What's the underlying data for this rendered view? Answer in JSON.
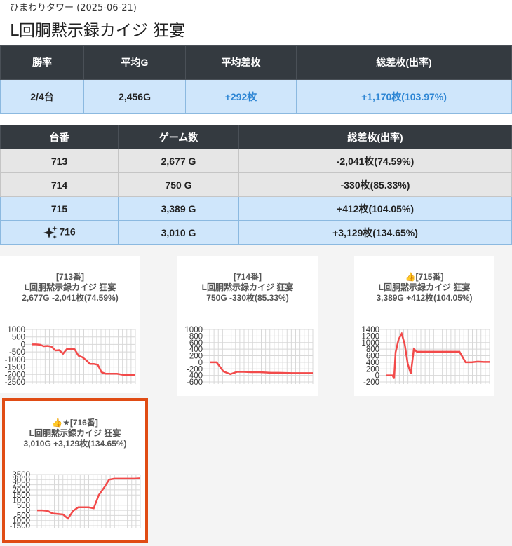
{
  "header": {
    "subtitle": "ひまわりタワー (2025-06-21)",
    "title": "L回胴黙示録カイジ 狂宴"
  },
  "summary": {
    "headers": [
      "勝率",
      "平均G",
      "平均差枚",
      "総差枚(出率)"
    ],
    "values": [
      "2/4台",
      "2,456G",
      "+292枚",
      "+1,170枚(103.97%)"
    ]
  },
  "machines": {
    "headers": [
      "台番",
      "ゲーム数",
      "総差枚(出率)"
    ],
    "rows": [
      {
        "number": "713",
        "games": "2,677 G",
        "total": "-2,041枚(74.59%)",
        "style": "gray"
      },
      {
        "number": "714",
        "games": "750 G",
        "total": "-330枚(85.33%)",
        "style": "gray"
      },
      {
        "number": "715",
        "games": "3,389 G",
        "total": "+412枚(104.05%)",
        "style": "blue"
      },
      {
        "number": "716",
        "games": "3,010 G",
        "total": "+3,129枚(134.65%)",
        "style": "blue",
        "icon": "sparkle-icon"
      }
    ]
  },
  "cards": [
    {
      "line1": "[713番]",
      "line2": "L回胴黙示録カイジ 狂宴",
      "line3": "2,677G -2,041枚(74.59%)",
      "highlighted": false
    },
    {
      "line1": "[714番]",
      "line2": "L回胴黙示録カイジ 狂宴",
      "line3": "750G -330枚(85.33%)",
      "highlighted": false
    },
    {
      "line1": "👍[715番]",
      "line2": "L回胴黙示録カイジ 狂宴",
      "line3": "3,389G +412枚(104.05%)",
      "highlighted": false
    },
    {
      "line1": "👍★[716番]",
      "line2": "L回胴黙示録カイジ 狂宴",
      "line3": "3,010G +3,129枚(134.65%)",
      "highlighted": true
    }
  ],
  "chart_data": [
    {
      "type": "line",
      "title": "[713番]",
      "yticks": [
        1000,
        500,
        0,
        -500,
        -1000,
        -1500,
        -2000,
        -2500
      ],
      "ylim": [
        -2500,
        1000
      ],
      "x": [
        0,
        100,
        200,
        300,
        400,
        500,
        600,
        700,
        800,
        900,
        1000,
        1100,
        1200,
        1300,
        1400,
        1500,
        1600,
        1700,
        1800,
        1900,
        2000,
        2100,
        2200,
        2300,
        2400,
        2500,
        2677
      ],
      "values": [
        0,
        0,
        -20,
        -120,
        -100,
        -150,
        -400,
        -380,
        -620,
        -300,
        -300,
        -320,
        -750,
        -850,
        -1050,
        -1300,
        -1300,
        -1350,
        -1850,
        -1950,
        -1950,
        -1950,
        -1950,
        -2000,
        -2041,
        -2041,
        -2041
      ],
      "color": "#f24a4a"
    },
    {
      "type": "line",
      "title": "[714番]",
      "yticks": [
        1000,
        800,
        600,
        400,
        200,
        0,
        -200,
        -400,
        -600
      ],
      "ylim": [
        -600,
        1000
      ],
      "x": [
        0,
        50,
        100,
        150,
        200,
        250,
        300,
        350,
        400,
        450,
        500,
        550,
        600,
        650,
        700,
        750
      ],
      "values": [
        0,
        0,
        -280,
        -360,
        -290,
        -290,
        -300,
        -300,
        -310,
        -320,
        -320,
        -325,
        -330,
        -330,
        -330,
        -330
      ],
      "color": "#f24a4a"
    },
    {
      "type": "line",
      "title": "[715番]",
      "yticks": [
        1400,
        1200,
        1000,
        800,
        600,
        400,
        200,
        0,
        -200
      ],
      "ylim": [
        -200,
        1400
      ],
      "x": [
        0,
        100,
        200,
        250,
        300,
        400,
        500,
        600,
        700,
        800,
        900,
        1000,
        1100,
        1200,
        1400,
        1600,
        1800,
        2000,
        2200,
        2400,
        2600,
        2800,
        3000,
        3200,
        3389
      ],
      "values": [
        0,
        0,
        0,
        -100,
        700,
        1100,
        1270,
        950,
        350,
        50,
        800,
        720,
        720,
        720,
        720,
        720,
        720,
        720,
        720,
        720,
        400,
        400,
        420,
        412,
        412
      ],
      "color": "#f24a4a"
    },
    {
      "type": "line",
      "title": "[716番]",
      "yticks": [
        3500,
        3000,
        2500,
        2000,
        1500,
        1000,
        500,
        0,
        -500,
        -1000,
        -1500
      ],
      "ylim": [
        -1500,
        3500
      ],
      "x": [
        0,
        150,
        300,
        450,
        600,
        750,
        900,
        1050,
        1200,
        1350,
        1500,
        1650,
        1800,
        1950,
        2100,
        2250,
        2400,
        2550,
        2700,
        2850,
        3010
      ],
      "values": [
        0,
        0,
        -50,
        -300,
        -350,
        -400,
        -800,
        -50,
        300,
        300,
        300,
        200,
        1500,
        2200,
        3000,
        3100,
        3100,
        3100,
        3100,
        3100,
        3129
      ],
      "color": "#f24a4a"
    }
  ]
}
